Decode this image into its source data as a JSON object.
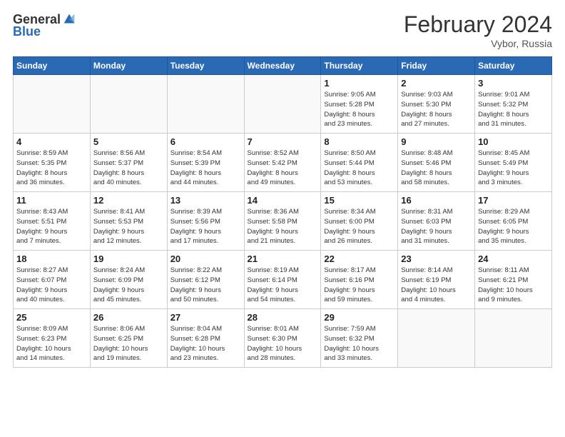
{
  "app": {
    "logo_general": "General",
    "logo_blue": "Blue",
    "month_title": "February 2024",
    "location": "Vybor, Russia"
  },
  "header_days": [
    "Sunday",
    "Monday",
    "Tuesday",
    "Wednesday",
    "Thursday",
    "Friday",
    "Saturday"
  ],
  "weeks": [
    [
      {
        "num": "",
        "info": ""
      },
      {
        "num": "",
        "info": ""
      },
      {
        "num": "",
        "info": ""
      },
      {
        "num": "",
        "info": ""
      },
      {
        "num": "1",
        "info": "Sunrise: 9:05 AM\nSunset: 5:28 PM\nDaylight: 8 hours\nand 23 minutes."
      },
      {
        "num": "2",
        "info": "Sunrise: 9:03 AM\nSunset: 5:30 PM\nDaylight: 8 hours\nand 27 minutes."
      },
      {
        "num": "3",
        "info": "Sunrise: 9:01 AM\nSunset: 5:32 PM\nDaylight: 8 hours\nand 31 minutes."
      }
    ],
    [
      {
        "num": "4",
        "info": "Sunrise: 8:59 AM\nSunset: 5:35 PM\nDaylight: 8 hours\nand 36 minutes."
      },
      {
        "num": "5",
        "info": "Sunrise: 8:56 AM\nSunset: 5:37 PM\nDaylight: 8 hours\nand 40 minutes."
      },
      {
        "num": "6",
        "info": "Sunrise: 8:54 AM\nSunset: 5:39 PM\nDaylight: 8 hours\nand 44 minutes."
      },
      {
        "num": "7",
        "info": "Sunrise: 8:52 AM\nSunset: 5:42 PM\nDaylight: 8 hours\nand 49 minutes."
      },
      {
        "num": "8",
        "info": "Sunrise: 8:50 AM\nSunset: 5:44 PM\nDaylight: 8 hours\nand 53 minutes."
      },
      {
        "num": "9",
        "info": "Sunrise: 8:48 AM\nSunset: 5:46 PM\nDaylight: 8 hours\nand 58 minutes."
      },
      {
        "num": "10",
        "info": "Sunrise: 8:45 AM\nSunset: 5:49 PM\nDaylight: 9 hours\nand 3 minutes."
      }
    ],
    [
      {
        "num": "11",
        "info": "Sunrise: 8:43 AM\nSunset: 5:51 PM\nDaylight: 9 hours\nand 7 minutes."
      },
      {
        "num": "12",
        "info": "Sunrise: 8:41 AM\nSunset: 5:53 PM\nDaylight: 9 hours\nand 12 minutes."
      },
      {
        "num": "13",
        "info": "Sunrise: 8:39 AM\nSunset: 5:56 PM\nDaylight: 9 hours\nand 17 minutes."
      },
      {
        "num": "14",
        "info": "Sunrise: 8:36 AM\nSunset: 5:58 PM\nDaylight: 9 hours\nand 21 minutes."
      },
      {
        "num": "15",
        "info": "Sunrise: 8:34 AM\nSunset: 6:00 PM\nDaylight: 9 hours\nand 26 minutes."
      },
      {
        "num": "16",
        "info": "Sunrise: 8:31 AM\nSunset: 6:03 PM\nDaylight: 9 hours\nand 31 minutes."
      },
      {
        "num": "17",
        "info": "Sunrise: 8:29 AM\nSunset: 6:05 PM\nDaylight: 9 hours\nand 35 minutes."
      }
    ],
    [
      {
        "num": "18",
        "info": "Sunrise: 8:27 AM\nSunset: 6:07 PM\nDaylight: 9 hours\nand 40 minutes."
      },
      {
        "num": "19",
        "info": "Sunrise: 8:24 AM\nSunset: 6:09 PM\nDaylight: 9 hours\nand 45 minutes."
      },
      {
        "num": "20",
        "info": "Sunrise: 8:22 AM\nSunset: 6:12 PM\nDaylight: 9 hours\nand 50 minutes."
      },
      {
        "num": "21",
        "info": "Sunrise: 8:19 AM\nSunset: 6:14 PM\nDaylight: 9 hours\nand 54 minutes."
      },
      {
        "num": "22",
        "info": "Sunrise: 8:17 AM\nSunset: 6:16 PM\nDaylight: 9 hours\nand 59 minutes."
      },
      {
        "num": "23",
        "info": "Sunrise: 8:14 AM\nSunset: 6:19 PM\nDaylight: 10 hours\nand 4 minutes."
      },
      {
        "num": "24",
        "info": "Sunrise: 8:11 AM\nSunset: 6:21 PM\nDaylight: 10 hours\nand 9 minutes."
      }
    ],
    [
      {
        "num": "25",
        "info": "Sunrise: 8:09 AM\nSunset: 6:23 PM\nDaylight: 10 hours\nand 14 minutes."
      },
      {
        "num": "26",
        "info": "Sunrise: 8:06 AM\nSunset: 6:25 PM\nDaylight: 10 hours\nand 19 minutes."
      },
      {
        "num": "27",
        "info": "Sunrise: 8:04 AM\nSunset: 6:28 PM\nDaylight: 10 hours\nand 23 minutes."
      },
      {
        "num": "28",
        "info": "Sunrise: 8:01 AM\nSunset: 6:30 PM\nDaylight: 10 hours\nand 28 minutes."
      },
      {
        "num": "29",
        "info": "Sunrise: 7:59 AM\nSunset: 6:32 PM\nDaylight: 10 hours\nand 33 minutes."
      },
      {
        "num": "",
        "info": ""
      },
      {
        "num": "",
        "info": ""
      }
    ]
  ]
}
